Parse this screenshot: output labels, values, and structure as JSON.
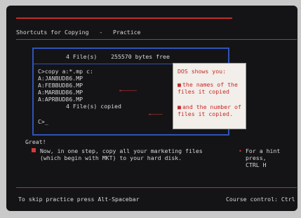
{
  "header": {
    "title": "Shortcuts for Copying",
    "subtitle": "Practice",
    "separator": "-"
  },
  "dos": {
    "header_line": "4 File(s)    255570 bytes free",
    "command": "C>copy a:*.mp c:",
    "files": [
      "A:JANBUD86.MP",
      "A:FEBBUD86.MP",
      "A:MARBUD86.MP",
      "A:APRBUD86.MP"
    ],
    "copied": "4 File(s) copied",
    "prompt": "C>_"
  },
  "callout": {
    "heading": "DOS shows you:",
    "bullet1": "the names of the files it copied",
    "bullet2": "and the number of files it copied."
  },
  "feedback": "Great!",
  "instruction": "Now, in one step, copy all your marketing files\n(which begin with MKT) to your hard disk.",
  "hint": "For a hint\npress,\nCTRL H",
  "footer": {
    "skip": "To skip practice press Alt-Spacebar",
    "course": "Course control: Ctrl"
  },
  "colors": {
    "accent_red": "#c42b2b",
    "window_blue": "#2f54b8",
    "callout_bg": "#f2eee9"
  }
}
